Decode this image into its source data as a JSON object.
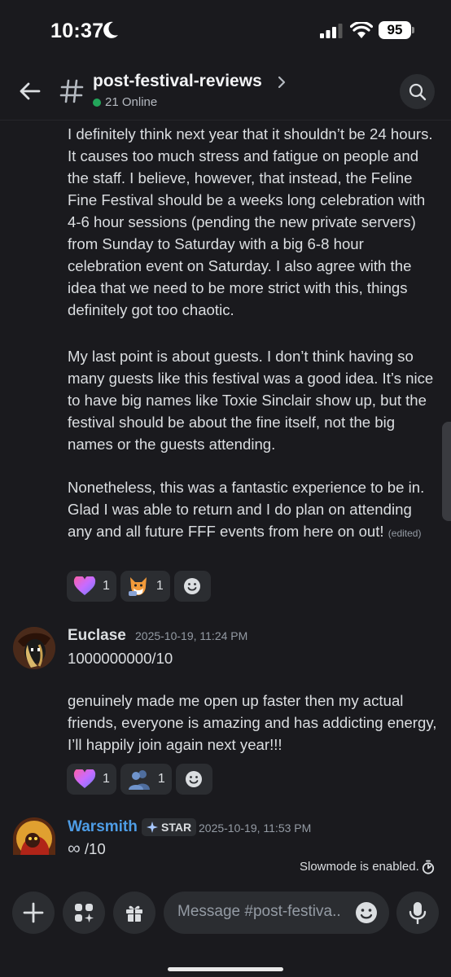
{
  "status_bar": {
    "time": "10:37",
    "battery": "95"
  },
  "header": {
    "channel_name": "post-festival-reviews",
    "online_count": "21 Online"
  },
  "messages": [
    {
      "paragraphs": [
        "I definitely think next year that it shouldn’t be 24 hours. It causes too much stress and fatigue on people and the staff. I believe, however, that instead, the Feline Fine Festival should be a weeks long celebration with 4-6 hour sessions (pending the new private servers) from Sunday to Saturday with a big 6-8 hour celebration event on Saturday. I also agree with the idea that we need to be more strict with this, things definitely got too chaotic.",
        "My last point is about guests. I don’t think having so many guests like this festival was a good idea. It’s nice to have big names like Toxie Sinclair show up, but the festival should be about the fine itself, not the big names or the guests attending.",
        "Nonetheless, this was a fantastic experience to be in. Glad I was able to return and I do plan on attending any and all future FFF events from here on out!"
      ],
      "edited_label": "(edited)",
      "reactions": [
        {
          "icon": "heart-emoji-icon",
          "count": "1"
        },
        {
          "icon": "fox-sticker-icon",
          "count": "1"
        }
      ]
    },
    {
      "author": "Euclase",
      "author_color": "#f2f3f5",
      "timestamp": "2025-10-19, 11:24 PM",
      "paragraphs": [
        "1000000000/10",
        "genuinely made me open up faster then my actual friends, everyone is amazing and has addicting energy, I’ll happily join again next year!!!"
      ],
      "reactions": [
        {
          "icon": "heart-emoji-icon",
          "count": "1"
        },
        {
          "icon": "people-emoji-icon",
          "count": "1"
        }
      ]
    },
    {
      "author": "Warsmith",
      "author_color": "#4e9de6",
      "tag": "STAR",
      "timestamp": "2025-10-19, 11:53 PM",
      "paragraphs": [
        "/10"
      ],
      "infinity": "∞"
    }
  ],
  "slowmode": "Slowmode is enabled.",
  "composer": {
    "placeholder": "Message #post-festiva.."
  },
  "colors": {
    "online": "#23a55a",
    "blurple": "#5865f2"
  }
}
